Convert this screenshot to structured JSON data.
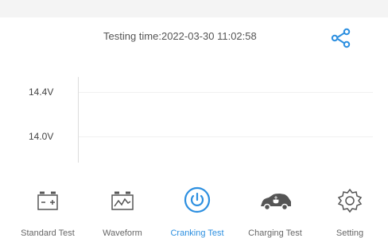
{
  "header": {
    "testing_time": "Testing time:2022-03-30 11:02:58",
    "share_icon": "share-icon"
  },
  "chart_data": {
    "type": "line",
    "ylabel": "",
    "yticks": [
      "14.4V",
      "14.0V"
    ],
    "series": []
  },
  "nav": {
    "active": "cranking-test",
    "items": [
      {
        "id": "standard-test",
        "label": "Standard Test",
        "icon": "battery-icon"
      },
      {
        "id": "waveform",
        "label": "Waveform",
        "icon": "waveform-icon"
      },
      {
        "id": "cranking-test",
        "label": "Cranking Test",
        "icon": "power-icon"
      },
      {
        "id": "charging-test",
        "label": "Charging Test",
        "icon": "car-icon"
      },
      {
        "id": "setting",
        "label": "Setting",
        "icon": "gear-icon"
      }
    ]
  },
  "colors": {
    "accent": "#2c8fe0",
    "icon_gray": "#555555",
    "text_gray": "#666666"
  }
}
